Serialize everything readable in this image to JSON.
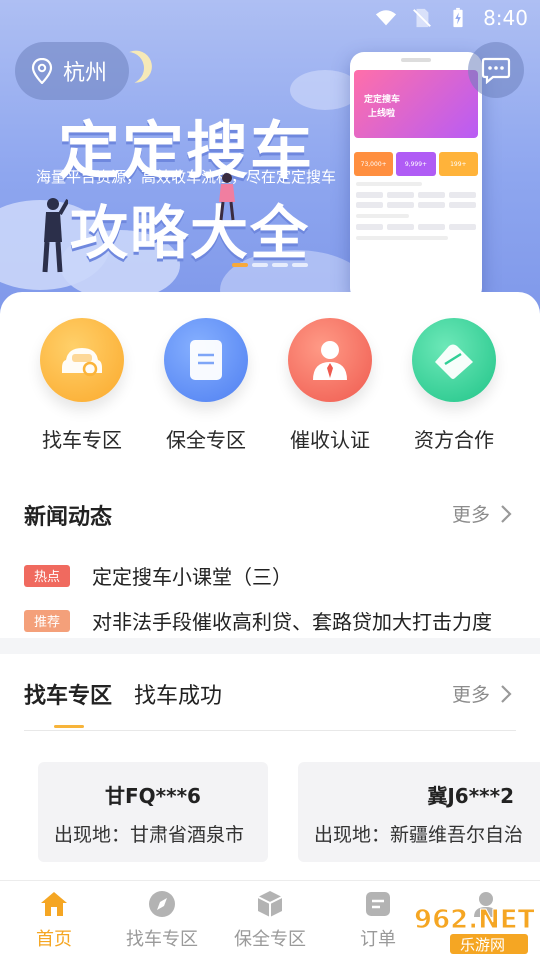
{
  "status_bar": {
    "time": "8:40"
  },
  "header": {
    "city": "杭州"
  },
  "banner": {
    "headline": "定定搜车",
    "subline": "海量平台资源，高效收车流程，尽在定定搜车",
    "headline2": "攻略大全",
    "phone_hero_1": "定定搜车",
    "phone_hero_2": "上线啦",
    "phone_cards": [
      "73,000+",
      "9,999+",
      "199+"
    ],
    "active_slide": 1,
    "slide_count": 4
  },
  "quick_entries": [
    {
      "label": "找车专区",
      "icon": "car-icon",
      "color": "#fbb43a"
    },
    {
      "label": "保全专区",
      "icon": "document-icon",
      "color": "#5b8cf5"
    },
    {
      "label": "催收认证",
      "icon": "person-icon",
      "color": "#f26a5a"
    },
    {
      "label": "资方合作",
      "icon": "handshake-icon",
      "color": "#2fcf96"
    }
  ],
  "news": {
    "title": "新闻动态",
    "more": "更多",
    "items": [
      {
        "tag": "热点",
        "tag_color": "#f06a5f",
        "text": "定定搜车小课堂（三）"
      },
      {
        "tag": "推荐",
        "tag_color": "#f4a07a",
        "text": "对非法手段催收高利贷、套路贷加大打击力度"
      }
    ]
  },
  "find_car": {
    "tabs": [
      "找车专区",
      "找车成功"
    ],
    "more": "更多",
    "cards": [
      {
        "plate": "甘FQ***6",
        "location": "出现地：甘肃省酒泉市"
      },
      {
        "plate": "冀J6***2",
        "location": "出现地：新疆维吾尔自治"
      }
    ]
  },
  "bottom_nav": [
    {
      "label": "首页",
      "icon": "home-icon",
      "active": true
    },
    {
      "label": "找车专区",
      "icon": "compass-icon",
      "active": false
    },
    {
      "label": "保全专区",
      "icon": "cube-icon",
      "active": false
    },
    {
      "label": "订单",
      "icon": "order-icon",
      "active": false
    },
    {
      "label": "",
      "icon": "user-icon",
      "active": false
    }
  ],
  "watermark": {
    "brand": "962.NET",
    "sub": "乐游网"
  },
  "colors": {
    "accent": "#f5a623",
    "banner": "#8ea6ef"
  }
}
